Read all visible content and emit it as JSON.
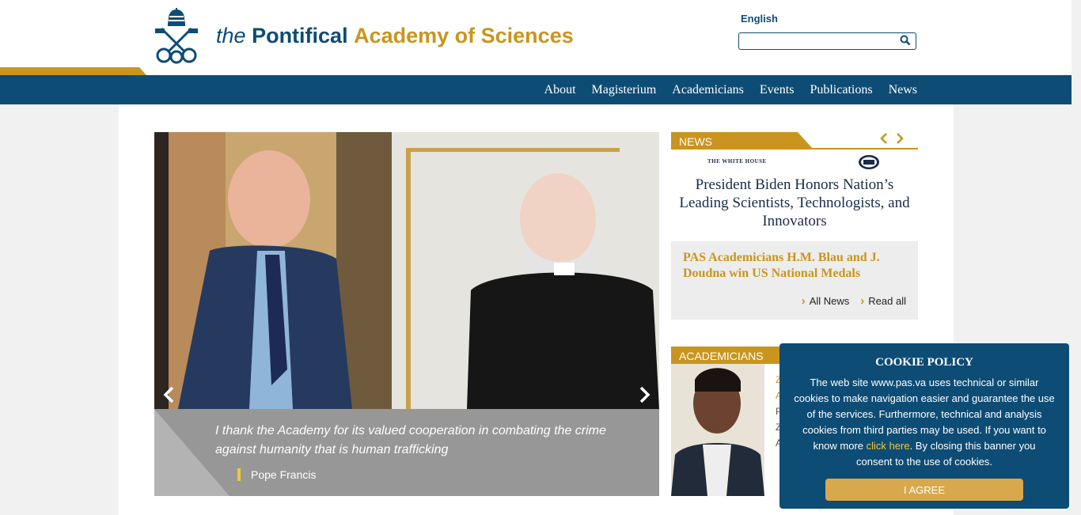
{
  "header": {
    "title_the": "the",
    "title_pontifical": "Pontifical",
    "title_academy": "Academy of Sciences",
    "language": "English",
    "search": {
      "value": "",
      "placeholder": ""
    }
  },
  "nav": {
    "items": [
      "About",
      "Magisterium",
      "Academicians",
      "Events",
      "Publications",
      "News"
    ]
  },
  "slider": {
    "quote": "I thank the Academy for its valued cooperation in combating the crime against humanity that is human trafficking",
    "author": "Pope Francis"
  },
  "news": {
    "tab_label": "NEWS",
    "image_label": "THE WHITE HOUSE",
    "image_headline": "President Biden Honors Nation’s Leading Scientists, Technologists, and Innovators",
    "title": "PAS Academicians H.M. Blau and J. Doudna win US National Medals",
    "all_news": "All News",
    "read_all": "Read all"
  },
  "academicians": {
    "tab_label": "ACADEMICIANS",
    "partial_text": [
      "Z",
      "A",
      "P",
      "Z",
      "A"
    ]
  },
  "cookie": {
    "title": "COOKIE POLICY",
    "text_before": "The web site www.pas.va uses technical or similar cookies to make navigation easier and guarantee the use of the services. Furthermore, technical and analysis cookies from third parties may be used. If you want to know more ",
    "link": "click here",
    "text_after": ". By closing this banner you consent to the use of cookies.",
    "button": "I AGREE"
  },
  "colors": {
    "navy": "#0d4c75",
    "gold": "#c9951e",
    "accent_yellow": "#f0c838",
    "agree_button": "#d8a84c"
  }
}
